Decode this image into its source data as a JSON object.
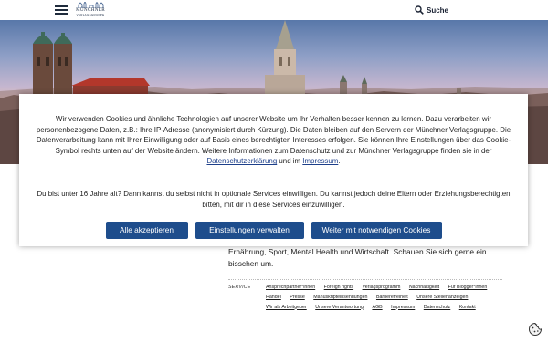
{
  "header": {
    "logo_line1": "MÜNCHNER",
    "logo_line2": "VERLAGSGRUPPE",
    "search_label": "Suche",
    "icons": [
      "menu-icon",
      "search-icon"
    ]
  },
  "cookie": {
    "para1_text": "Wir verwenden Cookies und ähnliche Technologien auf unserer Website um Ihr Verhalten besser kennen zu lernen. Dazu verarbeiten wir personenbezogene Daten, z.B.: Ihre IP-Adresse (anonymisiert durch Kürzung). Die Daten bleiben auf den Servern der Münchner Verlagsgruppe. Die Datenverarbeitung kann mit Ihrer Einwilligung oder auf Basis eines berechtigten Interesses erfolgen. Sie können Ihre Einstellungen über das Cookie-Symbol rechts unten auf der Website ändern. Weitere Informationen zum Datenschutz und zur Münchner Verlagsgruppe finden sie in der ",
    "privacy_link": "Datenschutzerklärung",
    "and_text": " und im ",
    "imprint_link": "Impressum",
    "end_text": ".",
    "para2": "Du bist unter 16 Jahre alt? Dann kannst du selbst nicht in optionale Services einwilligen. Du kannst jedoch deine Eltern oder Erziehungsberechtigten bitten, mit dir in diese Services einzuwilligen.",
    "accept_all": "Alle akzeptieren",
    "manage": "Einstellungen verwalten",
    "necessary_only": "Weiter mit notwendigen Cookies",
    "fab_icon": "cookie-icon"
  },
  "content": {
    "text": "Ernährung, Sport, Mental Health und Wirtschaft. Schauen Sie sich gerne ein bisschen um."
  },
  "footer": {
    "service_label": "SERVICE",
    "links": [
      "Ansprechpartner*innen",
      "Foreign rights",
      "Verlagsprogramm",
      "Nachhaltigkeit",
      "Für Blogger*innen",
      "Handel",
      "Presse",
      "Manuskripteinsendungen",
      "Barrierefreiheit",
      "Unsere Stellenanzeigen",
      "Wir als Arbeitgeber",
      "Unsere Verantwortung",
      "AGB",
      "Impressum",
      "Datenschutz",
      "Kontakt"
    ]
  },
  "colors": {
    "button": "#1e4d8c",
    "link": "#1d3f8a",
    "header_text": "#1a2233"
  }
}
